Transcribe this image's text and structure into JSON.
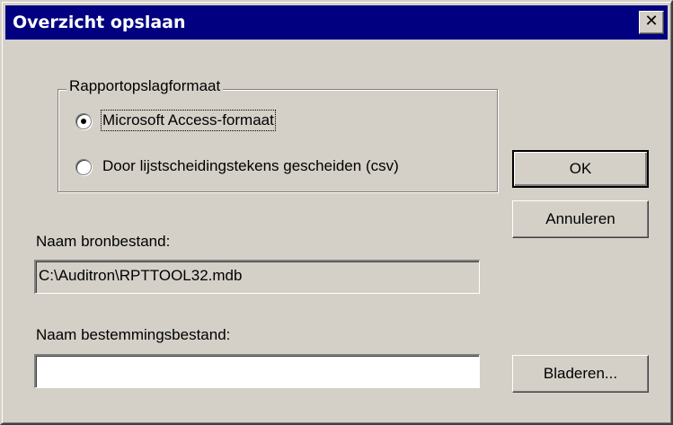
{
  "window": {
    "title": "Overzicht opslaan",
    "close_glyph": "✕"
  },
  "format_group": {
    "label": "Rapportopslagformaat",
    "options": [
      {
        "label": "Microsoft Access-formaat",
        "selected": true
      },
      {
        "label": "Door lijstscheidingstekens gescheiden (csv)",
        "selected": false
      }
    ]
  },
  "source": {
    "label": "Naam bronbestand:",
    "value": "C:\\Auditron\\RPTTOOL32.mdb"
  },
  "destination": {
    "label": "Naam bestemmingsbestand:",
    "value": ""
  },
  "buttons": {
    "ok": "OK",
    "cancel": "Annuleren",
    "browse": "Bladeren..."
  }
}
